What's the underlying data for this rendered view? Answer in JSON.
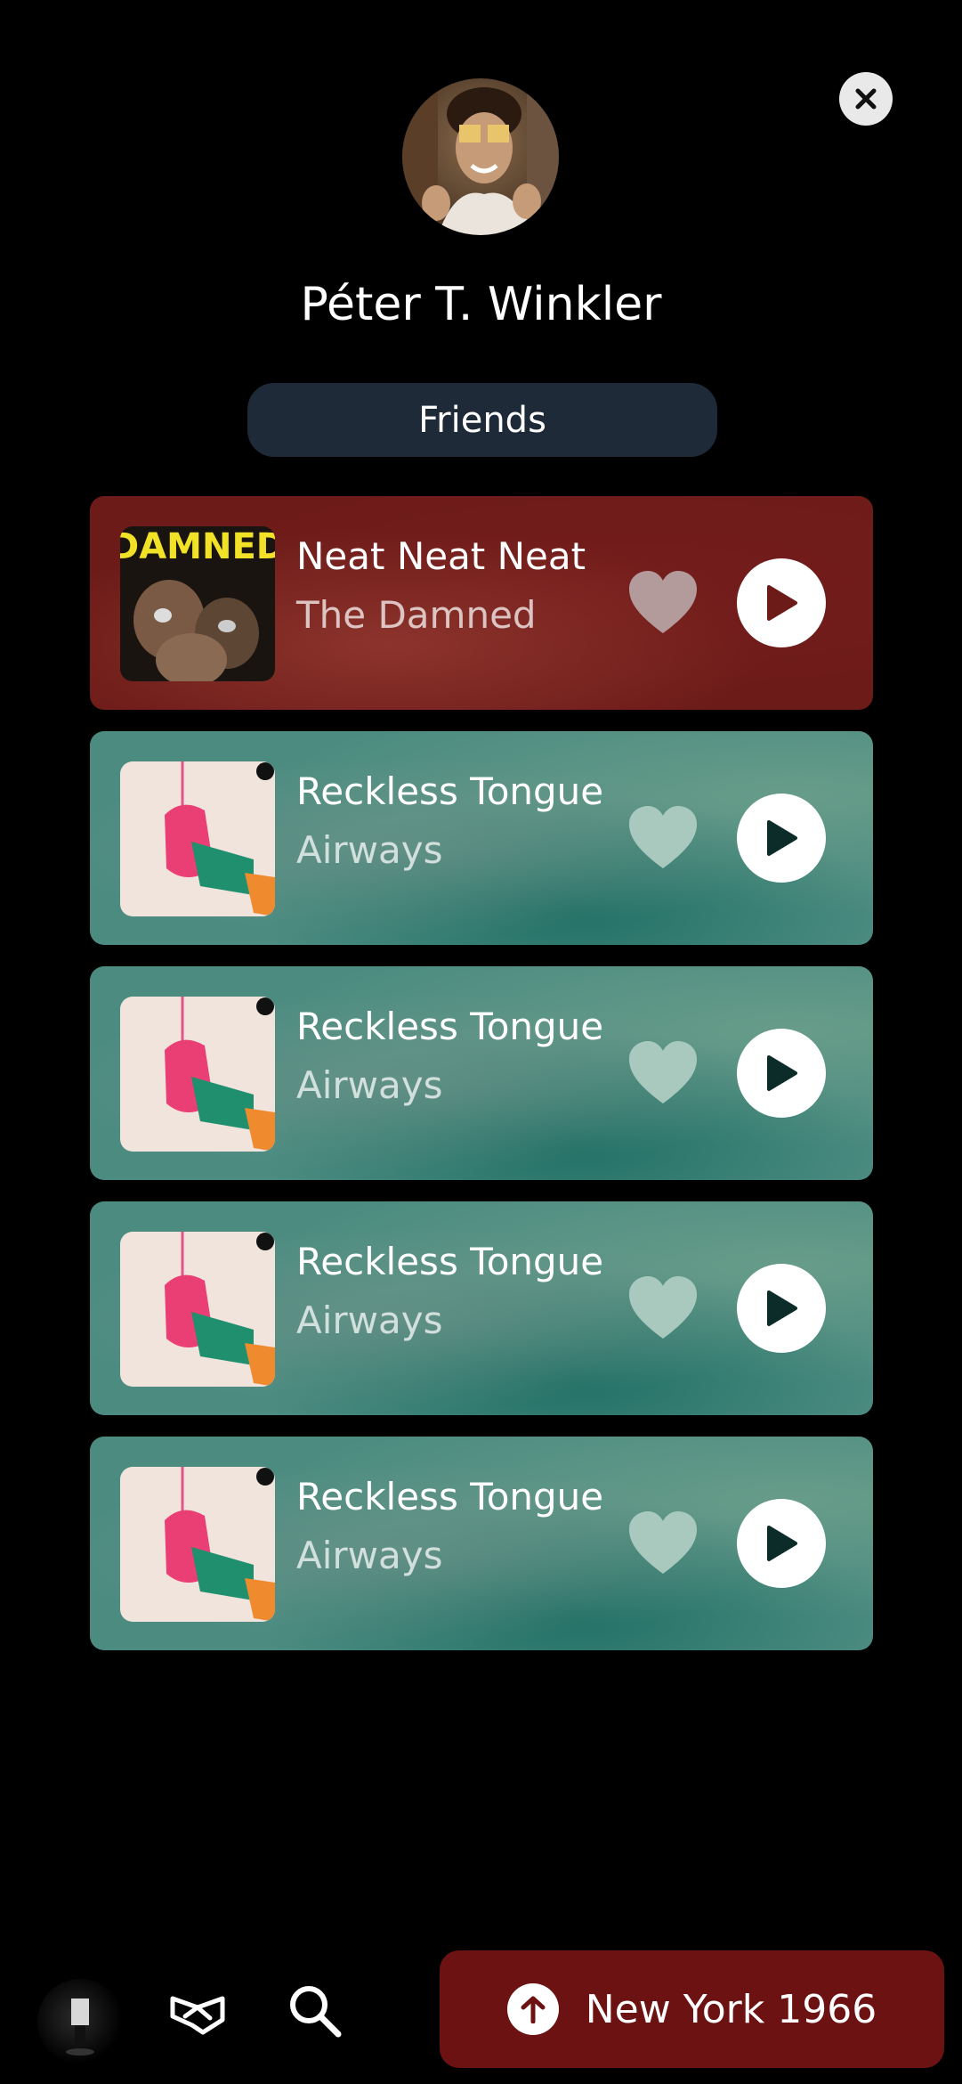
{
  "profile": {
    "name": "Péter T. Winkler",
    "friends_label": "Friends"
  },
  "colors": {
    "background": "#000000",
    "friends_button": "#1f2a38",
    "card_red": "#6d1b19",
    "card_teal": "#4b8b80",
    "city_button": "#6d1212"
  },
  "tracks": [
    {
      "title": "Neat Neat Neat",
      "artist": "The Damned",
      "cover_text": "DAMNED",
      "theme": "red"
    },
    {
      "title": "Reckless Tongue",
      "artist": "Airways",
      "theme": "teal"
    },
    {
      "title": "Reckless Tongue",
      "artist": "Airways",
      "theme": "teal"
    },
    {
      "title": "Reckless Tongue",
      "artist": "Airways",
      "theme": "teal"
    },
    {
      "title": "Reckless Tongue",
      "artist": "Airways",
      "theme": "teal"
    }
  ],
  "bottom_bar": {
    "city_label": "New York 1966",
    "icons": [
      "profile-thumbnail",
      "handshake-icon",
      "search-icon",
      "arrow-up-icon"
    ]
  }
}
